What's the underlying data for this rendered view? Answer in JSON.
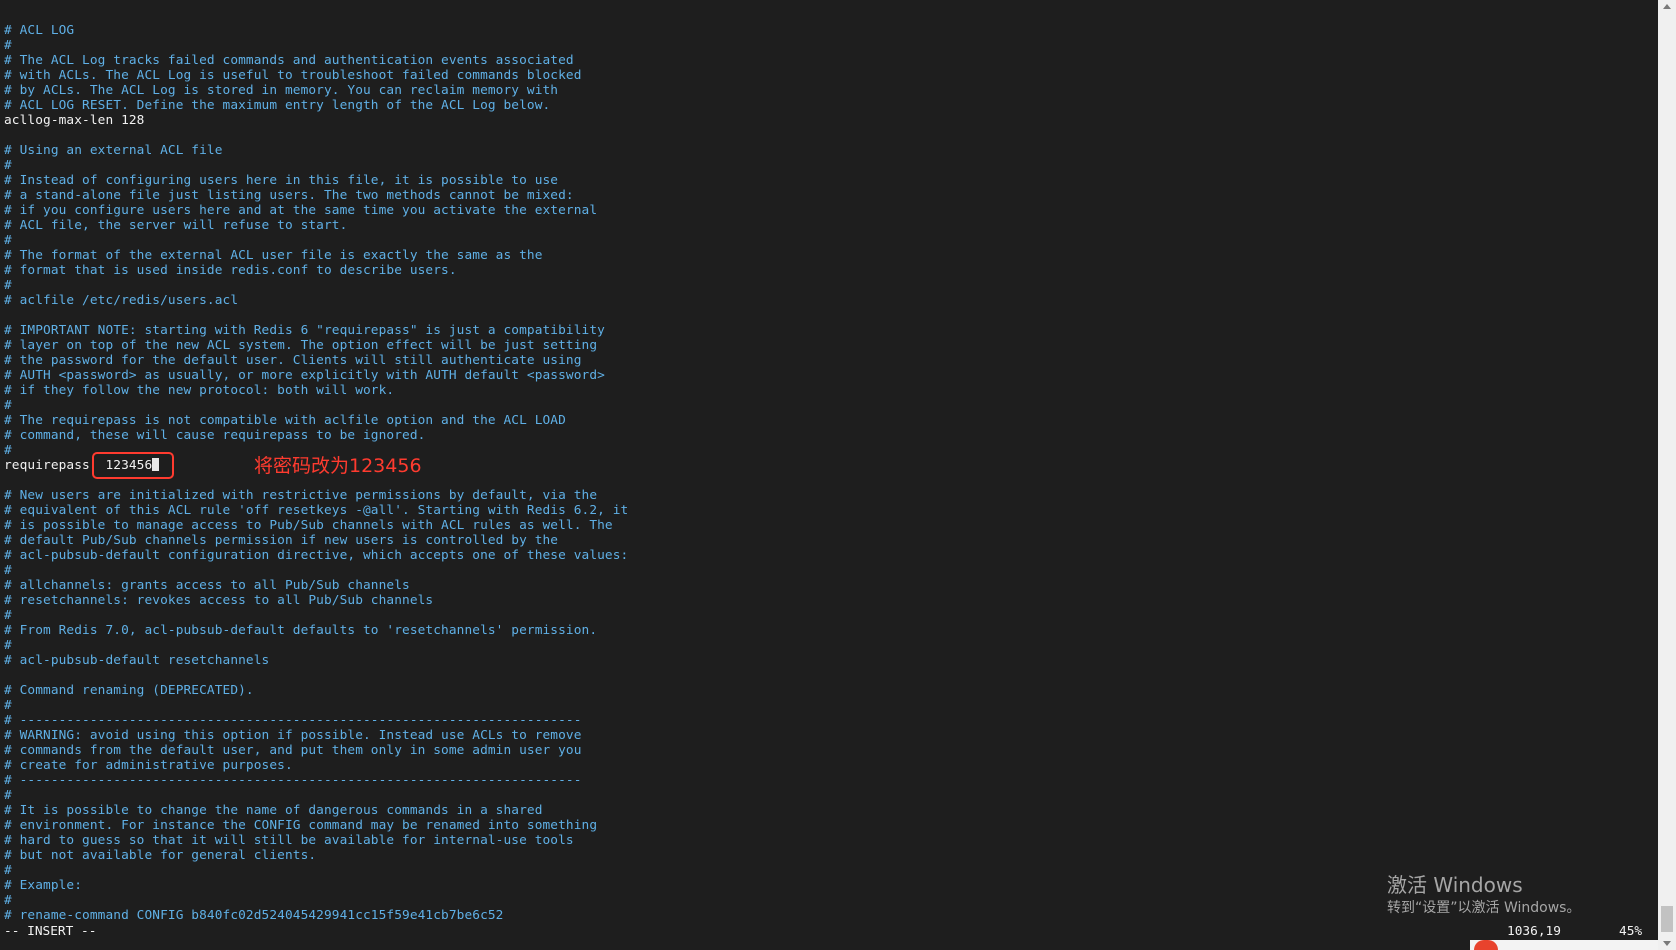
{
  "editor": {
    "lines": [
      {
        "type": "comment",
        "text": "# ACL LOG"
      },
      {
        "type": "comment",
        "text": "#"
      },
      {
        "type": "comment",
        "text": "# The ACL Log tracks failed commands and authentication events associated"
      },
      {
        "type": "comment",
        "text": "# with ACLs. The ACL Log is useful to troubleshoot failed commands blocked"
      },
      {
        "type": "comment",
        "text": "# by ACLs. The ACL Log is stored in memory. You can reclaim memory with"
      },
      {
        "type": "comment",
        "text": "# ACL LOG RESET. Define the maximum entry length of the ACL Log below."
      },
      {
        "type": "code",
        "text": "acllog-max-len 128"
      },
      {
        "type": "blank",
        "text": ""
      },
      {
        "type": "comment",
        "text": "# Using an external ACL file"
      },
      {
        "type": "comment",
        "text": "#"
      },
      {
        "type": "comment",
        "text": "# Instead of configuring users here in this file, it is possible to use"
      },
      {
        "type": "comment",
        "text": "# a stand-alone file just listing users. The two methods cannot be mixed:"
      },
      {
        "type": "comment",
        "text": "# if you configure users here and at the same time you activate the external"
      },
      {
        "type": "comment",
        "text": "# ACL file, the server will refuse to start."
      },
      {
        "type": "comment",
        "text": "#"
      },
      {
        "type": "comment",
        "text": "# The format of the external ACL user file is exactly the same as the"
      },
      {
        "type": "comment",
        "text": "# format that is used inside redis.conf to describe users."
      },
      {
        "type": "comment",
        "text": "#"
      },
      {
        "type": "comment",
        "text": "# aclfile /etc/redis/users.acl"
      },
      {
        "type": "blank",
        "text": ""
      },
      {
        "type": "comment",
        "text": "# IMPORTANT NOTE: starting with Redis 6 \"requirepass\" is just a compatibility"
      },
      {
        "type": "comment",
        "text": "# layer on top of the new ACL system. The option effect will be just setting"
      },
      {
        "type": "comment",
        "text": "# the password for the default user. Clients will still authenticate using"
      },
      {
        "type": "comment",
        "text": "# AUTH <password> as usually, or more explicitly with AUTH default <password>"
      },
      {
        "type": "comment",
        "text": "# if they follow the new protocol: both will work."
      },
      {
        "type": "comment",
        "text": "#"
      },
      {
        "type": "comment",
        "text": "# The requirepass is not compatible with aclfile option and the ACL LOAD"
      },
      {
        "type": "comment",
        "text": "# command, these will cause requirepass to be ignored."
      },
      {
        "type": "comment",
        "text": "#"
      },
      {
        "type": "requirepass",
        "key": "requirepass",
        "value": "123456"
      },
      {
        "type": "blank",
        "text": ""
      },
      {
        "type": "comment",
        "text": "# New users are initialized with restrictive permissions by default, via the"
      },
      {
        "type": "comment",
        "text": "# equivalent of this ACL rule 'off resetkeys -@all'. Starting with Redis 6.2, it"
      },
      {
        "type": "comment",
        "text": "# is possible to manage access to Pub/Sub channels with ACL rules as well. The"
      },
      {
        "type": "comment",
        "text": "# default Pub/Sub channels permission if new users is controlled by the"
      },
      {
        "type": "comment",
        "text": "# acl-pubsub-default configuration directive, which accepts one of these values:"
      },
      {
        "type": "comment",
        "text": "#"
      },
      {
        "type": "comment",
        "text": "# allchannels: grants access to all Pub/Sub channels"
      },
      {
        "type": "comment",
        "text": "# resetchannels: revokes access to all Pub/Sub channels"
      },
      {
        "type": "comment",
        "text": "#"
      },
      {
        "type": "comment",
        "text": "# From Redis 7.0, acl-pubsub-default defaults to 'resetchannels' permission."
      },
      {
        "type": "comment",
        "text": "#"
      },
      {
        "type": "comment",
        "text": "# acl-pubsub-default resetchannels"
      },
      {
        "type": "blank",
        "text": ""
      },
      {
        "type": "comment",
        "text": "# Command renaming (DEPRECATED)."
      },
      {
        "type": "comment",
        "text": "#"
      },
      {
        "type": "comment",
        "text": "# ------------------------------------------------------------------------"
      },
      {
        "type": "comment",
        "text": "# WARNING: avoid using this option if possible. Instead use ACLs to remove"
      },
      {
        "type": "comment",
        "text": "# commands from the default user, and put them only in some admin user you"
      },
      {
        "type": "comment",
        "text": "# create for administrative purposes."
      },
      {
        "type": "comment",
        "text": "# ------------------------------------------------------------------------"
      },
      {
        "type": "comment",
        "text": "#"
      },
      {
        "type": "comment",
        "text": "# It is possible to change the name of dangerous commands in a shared"
      },
      {
        "type": "comment",
        "text": "# environment. For instance the CONFIG command may be renamed into something"
      },
      {
        "type": "comment",
        "text": "# hard to guess so that it will still be available for internal-use tools"
      },
      {
        "type": "comment",
        "text": "# but not available for general clients."
      },
      {
        "type": "comment",
        "text": "#"
      },
      {
        "type": "comment",
        "text": "# Example:"
      },
      {
        "type": "comment",
        "text": "#"
      },
      {
        "type": "comment",
        "text": "# rename-command CONFIG b840fc02d524045429941cc15f59e41cb7be6c52"
      }
    ]
  },
  "annotation": {
    "text": "将密码改为123456",
    "color": "#ff3b2f"
  },
  "statusbar": {
    "mode": "-- INSERT --",
    "position": "1036,19",
    "percent": "45%"
  },
  "watermark": {
    "title": "激活 Windows",
    "subtitle": "转到“设置”以激活 Windows。"
  },
  "colors": {
    "background": "#1e1e1e",
    "comment": "#5fb0e6",
    "code": "#f2f2f2"
  }
}
